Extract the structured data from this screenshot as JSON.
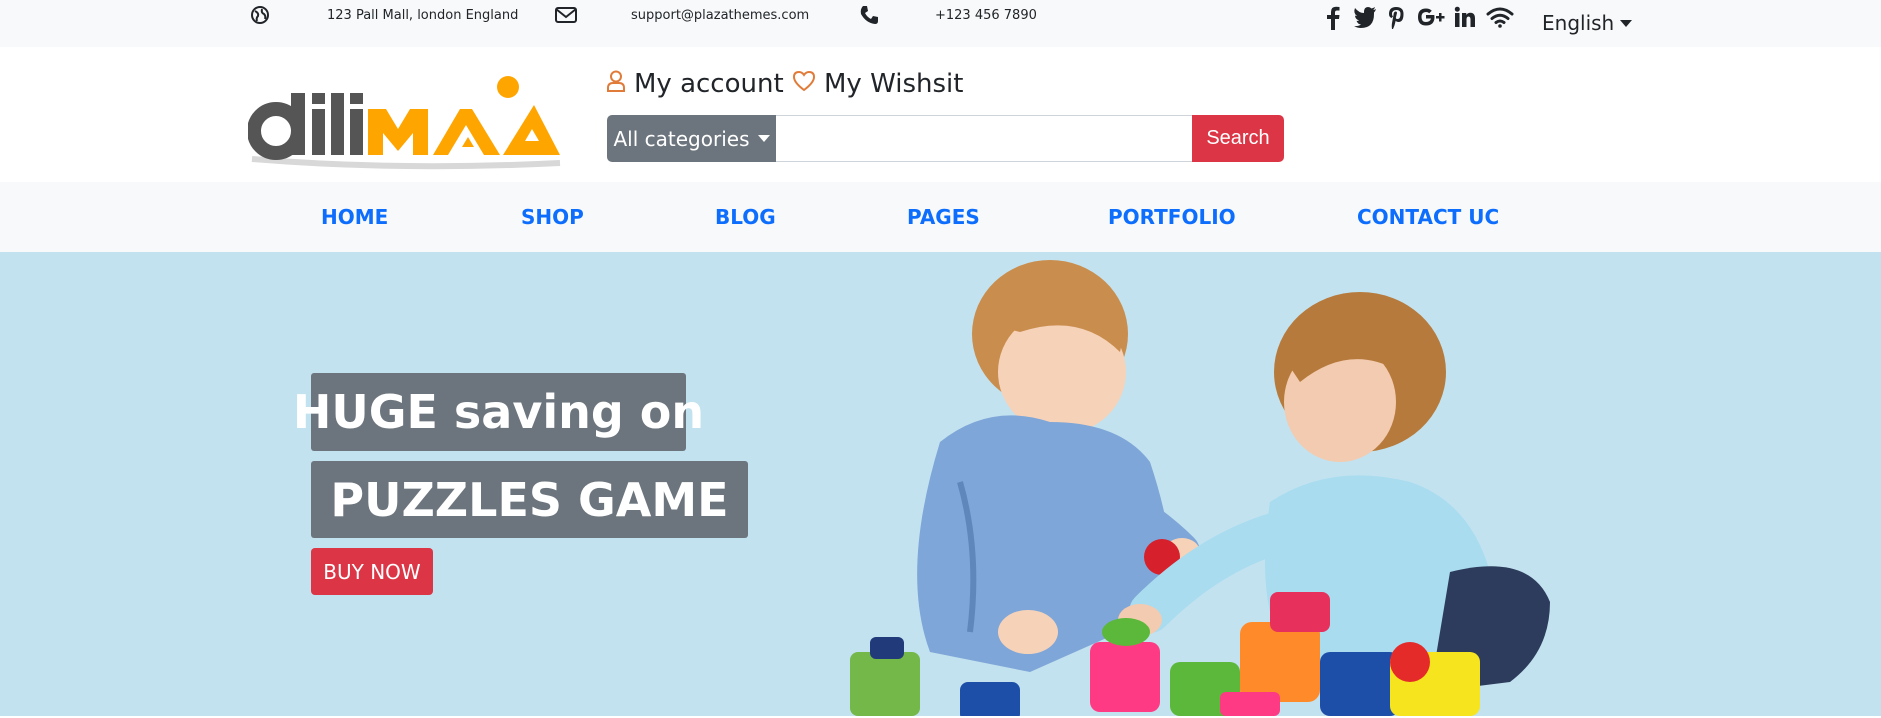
{
  "topbar": {
    "address": "123 Pall Mall, london England",
    "email": "support@plazathemes.com",
    "phone": "+123 456 7890",
    "social_icons": [
      "facebook-icon",
      "twitter-icon",
      "pinterest-icon",
      "google-plus-icon",
      "linkedin-icon",
      "wifi-icon"
    ],
    "language": "English"
  },
  "header": {
    "logo_alt": "dilima",
    "my_account": "My account",
    "my_wishlist": "My Wishsit",
    "categories_label": "All categories",
    "search_placeholder": "",
    "search_button": "Search"
  },
  "nav": {
    "items": [
      "HOME",
      "SHOP",
      "BLOG",
      "PAGES",
      "PORTFOLIO",
      "CONTACT UC"
    ]
  },
  "hero": {
    "line1": "HUGE saving on",
    "line2": "PUZZLES GAME",
    "cta": "BUY NOW"
  },
  "colors": {
    "accent_red": "#dc3545",
    "nav_blue": "#0d6efd",
    "gray_button": "#6c757d",
    "hero_bg": "#c3e2ef",
    "logo_orange": "#ffa500",
    "logo_gray": "#555555"
  }
}
